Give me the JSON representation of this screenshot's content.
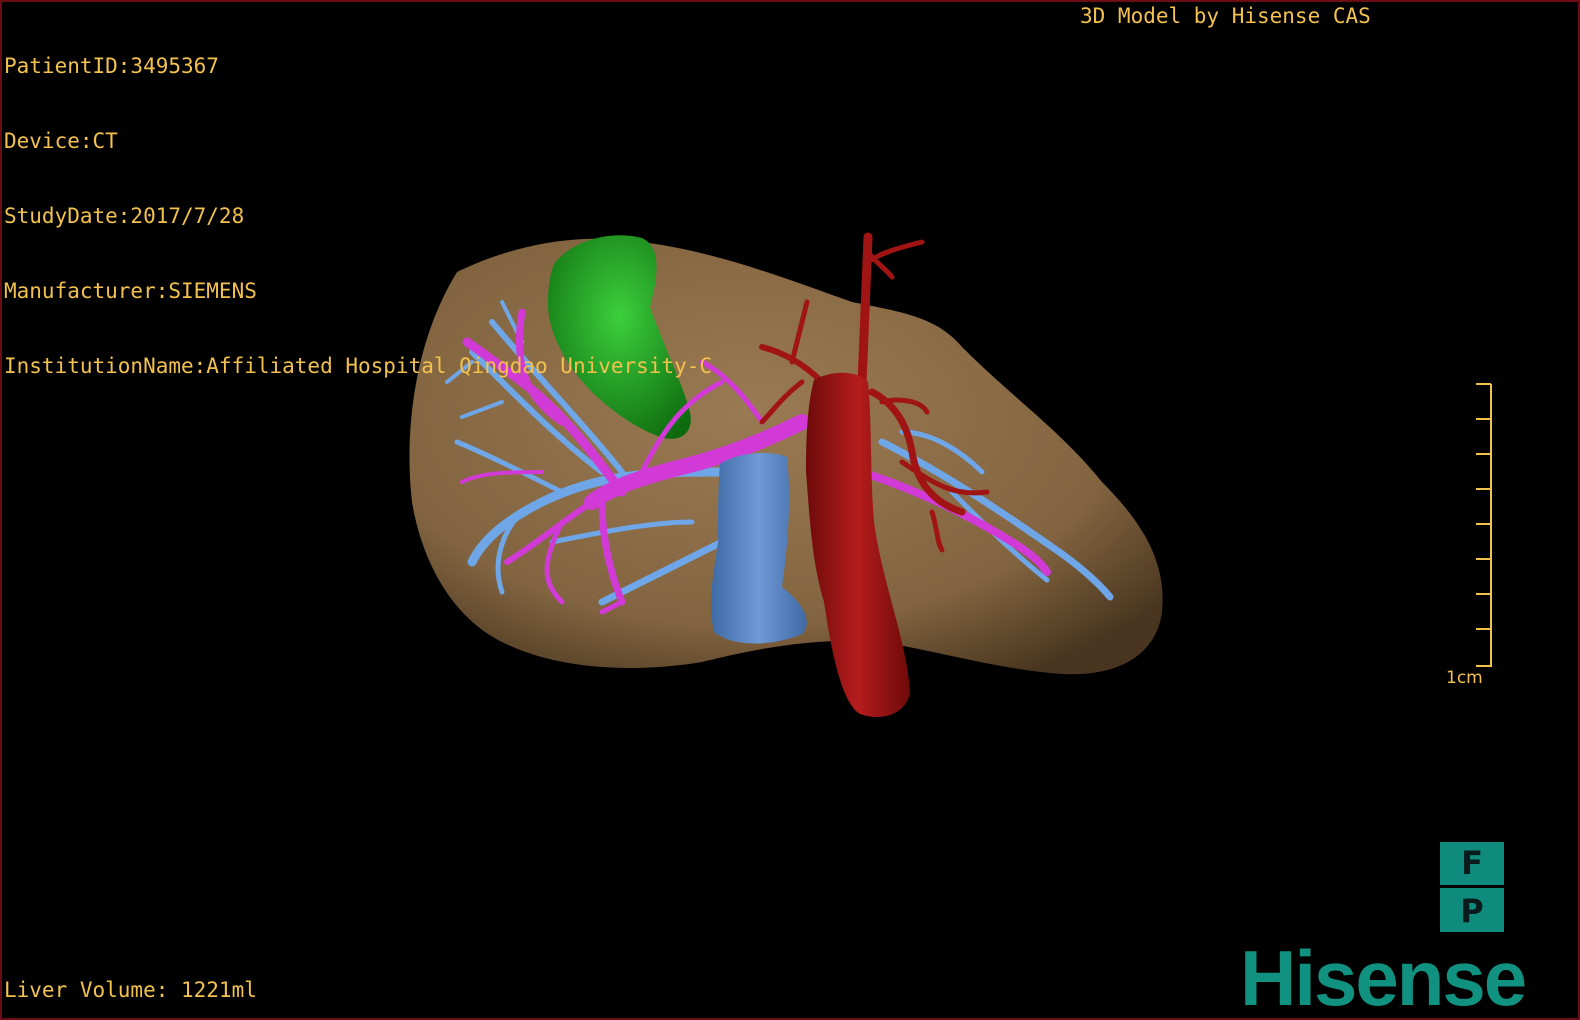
{
  "overlay": {
    "patient_id": "PatientID:3495367",
    "device": "Device:CT",
    "study_date": "StudyDate:2017/7/28",
    "manufacturer": "Manufacturer:SIEMENS",
    "institution": "InstitutionName:Affiliated Hospital Qingdao University-C",
    "model_credit": "3D Model by Hisense CAS",
    "liver_volume": "Liver Volume: 1221ml"
  },
  "scale": {
    "label": "1cm"
  },
  "orientation": {
    "top_letter": "F",
    "bottom_letter": "P"
  },
  "brand": {
    "logo_text": "Hisense"
  },
  "colors": {
    "text": "#f2c14e",
    "liver": "#8b6b45",
    "gallbladder": "#1c9a1c",
    "portal_vein": "#d13ad6",
    "hepatic_vein": "#6fa6e8",
    "ivc": "#5b86c4",
    "aorta": "#a11414",
    "brand": "#11917f"
  }
}
